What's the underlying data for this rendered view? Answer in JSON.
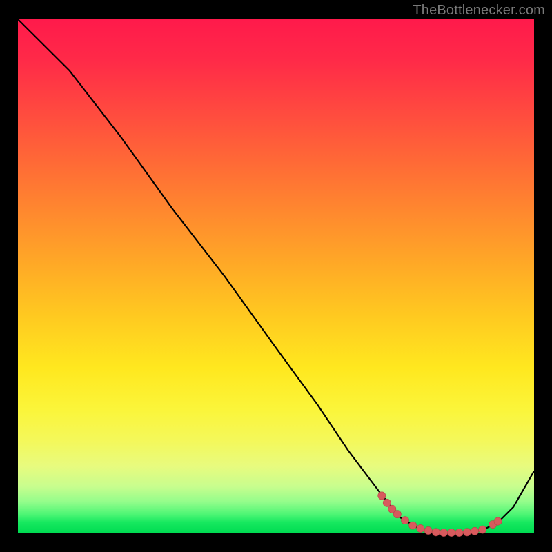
{
  "attribution": "TheBottlenecker.com",
  "chart_data": {
    "type": "line",
    "title": "",
    "xlabel": "",
    "ylabel": "",
    "xlim": [
      0,
      100
    ],
    "ylim": [
      0,
      100
    ],
    "series": [
      {
        "name": "curve",
        "points": [
          {
            "x": 0,
            "y": 100
          },
          {
            "x": 6,
            "y": 94
          },
          {
            "x": 10,
            "y": 90
          },
          {
            "x": 20,
            "y": 77
          },
          {
            "x": 30,
            "y": 63
          },
          {
            "x": 40,
            "y": 50
          },
          {
            "x": 50,
            "y": 36
          },
          {
            "x": 58,
            "y": 25
          },
          {
            "x": 64,
            "y": 16
          },
          {
            "x": 70,
            "y": 8
          },
          {
            "x": 74,
            "y": 3
          },
          {
            "x": 78,
            "y": 0.6
          },
          {
            "x": 82,
            "y": 0
          },
          {
            "x": 86,
            "y": 0
          },
          {
            "x": 90,
            "y": 0.5
          },
          {
            "x": 93,
            "y": 2
          },
          {
            "x": 96,
            "y": 5
          },
          {
            "x": 100,
            "y": 12
          }
        ]
      }
    ],
    "markers": {
      "name": "highlight-range",
      "color": "#d75a5d",
      "points": [
        {
          "x": 70.5,
          "y": 7.2
        },
        {
          "x": 71.5,
          "y": 5.8
        },
        {
          "x": 72.5,
          "y": 4.6
        },
        {
          "x": 73.5,
          "y": 3.6
        },
        {
          "x": 75.0,
          "y": 2.4
        },
        {
          "x": 76.5,
          "y": 1.4
        },
        {
          "x": 78.0,
          "y": 0.8
        },
        {
          "x": 79.5,
          "y": 0.4
        },
        {
          "x": 81.0,
          "y": 0.1
        },
        {
          "x": 82.5,
          "y": 0.0
        },
        {
          "x": 84.0,
          "y": 0.0
        },
        {
          "x": 85.5,
          "y": 0.0
        },
        {
          "x": 87.0,
          "y": 0.1
        },
        {
          "x": 88.5,
          "y": 0.3
        },
        {
          "x": 90.0,
          "y": 0.6
        },
        {
          "x": 92.0,
          "y": 1.6
        },
        {
          "x": 93.0,
          "y": 2.2
        }
      ]
    }
  }
}
